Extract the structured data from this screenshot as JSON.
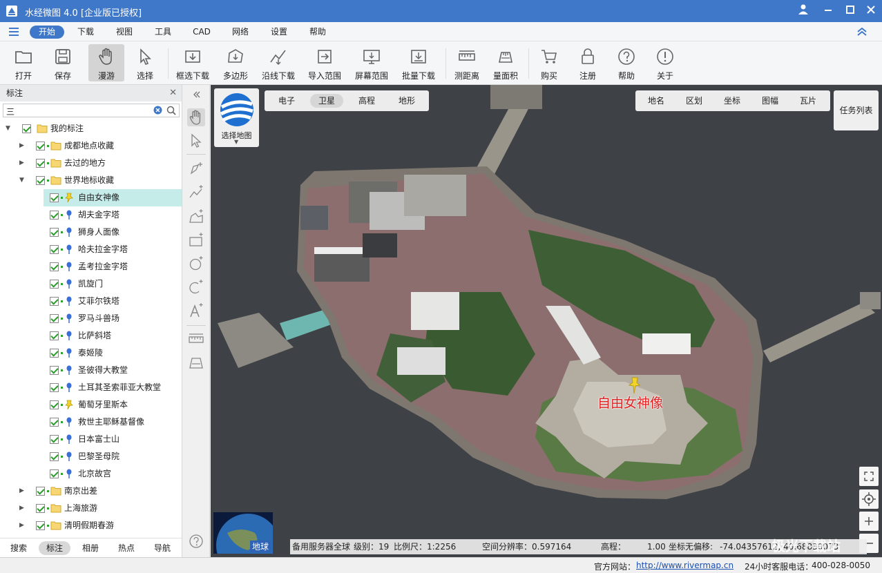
{
  "app": {
    "title": "水经微图 4.0 [企业版已授权]"
  },
  "menu": {
    "items": [
      "开始",
      "下载",
      "视图",
      "工具",
      "CAD",
      "网络",
      "设置",
      "帮助"
    ],
    "active": "开始"
  },
  "toolbar": {
    "open": "打开",
    "save": "保存",
    "roam": "漫游",
    "select": "选择",
    "rect_download": "框选下载",
    "polygon": "多边形",
    "line_download": "沿线下载",
    "import_range": "导入范围",
    "screen_range": "屏幕范围",
    "batch_download": "批量下载",
    "measure_distance": "测距离",
    "measure_area": "量面积",
    "buy": "购买",
    "register": "注册",
    "help": "帮助",
    "about": "关于"
  },
  "left_panel": {
    "title": "标注",
    "search_value": "三",
    "tree": {
      "root": "我的标注",
      "folders": [
        "成都地点收藏",
        "去过的地方",
        "世界地标收藏"
      ],
      "landmarks": [
        "自由女神像",
        "胡夫金字塔",
        "狮身人面像",
        "哈夫拉金字塔",
        "孟考拉金字塔",
        "凯旋门",
        "艾菲尔铁塔",
        "罗马斗兽场",
        "比萨斜塔",
        "泰姬陵",
        "圣彼得大教堂",
        "土耳其圣索菲亚大教堂",
        "葡萄牙里斯本",
        "救世主耶稣基督像",
        "日本富士山",
        "巴黎圣母院",
        "北京故宫"
      ],
      "bottom_folders": [
        "南京出差",
        "上海旅游",
        "清明假期春游"
      ]
    },
    "tabs": [
      "搜索",
      "标注",
      "相册",
      "热点",
      "导航"
    ],
    "active_tab": "标注"
  },
  "map": {
    "select_map": "选择地图",
    "types": [
      "电子",
      "卫星",
      "高程",
      "地形"
    ],
    "active_type": "卫星",
    "right_tools": [
      "地名",
      "区划",
      "坐标",
      "图幅",
      "瓦片"
    ],
    "task_list": "任务列表",
    "marker_label": "自由女神像",
    "globe_label": "地球",
    "info": {
      "server": "备用服务器全球",
      "level": "级别：19",
      "scale": "比例尺：1:2256",
      "resolution": "空间分辨率：0.597164",
      "elevation_label": "高程：",
      "elevation_value": "1.00",
      "coords_label": "坐标无偏移:",
      "coords_value": "-74.04357612, 40.68830073"
    }
  },
  "status": {
    "site_label": "官方网站：",
    "site_url": "http://www.rivermap.cn",
    "hotline_label": "24小时客服电话：",
    "hotline": "400-028-0050"
  },
  "watermark": "极光下载站",
  "colors": {
    "title_bar": "#3f78c9",
    "selected_row": "#c6ecea",
    "marker_text": "#e02020"
  }
}
